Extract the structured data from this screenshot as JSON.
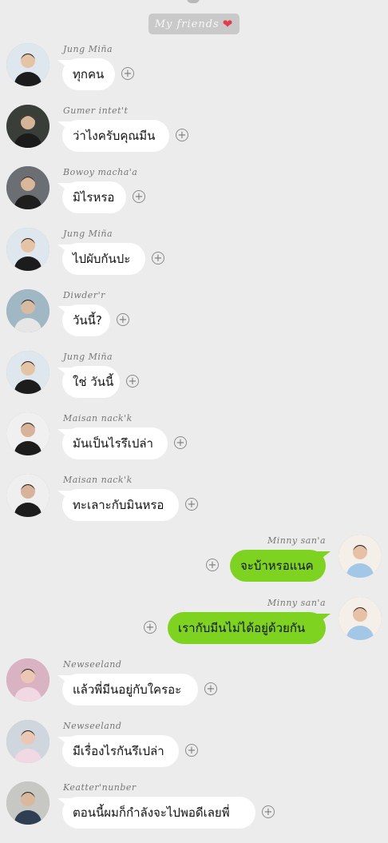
{
  "chat": {
    "title": "My friends",
    "title_icon": "heart-emoji",
    "messages": [
      {
        "side": "left",
        "sender": "Jung Miña",
        "text": "ทุกคน"
      },
      {
        "side": "left",
        "sender": "Gumer intet't",
        "text": "ว่าไงครับคุณมีน"
      },
      {
        "side": "left",
        "sender": "Bowoy macha'a",
        "text": "มิไรหรอ"
      },
      {
        "side": "left",
        "sender": "Jung Miña",
        "text": "ไปผับกันปะ"
      },
      {
        "side": "left",
        "sender": "Diwder'r",
        "text": "วันนี้?"
      },
      {
        "side": "left",
        "sender": "Jung Miña",
        "text": "ใช่ วันนี้"
      },
      {
        "side": "left",
        "sender": "Maisan nack'k",
        "text": "มันเป็นไรรึเปล่า"
      },
      {
        "side": "left",
        "sender": "Maisan nack'k",
        "text": "ทะเลาะกับมินหรอ"
      },
      {
        "side": "right",
        "sender": "Minny san'a",
        "text": "จะบ้าหรอแนค"
      },
      {
        "side": "right",
        "sender": "Minny san'a",
        "text": "เรากับมีนไม่ได้อยู่ด้วยกัน"
      },
      {
        "side": "left",
        "sender": "Newseeland",
        "text": "แล้วพี่มีนอยู่กับใครอะ"
      },
      {
        "side": "left",
        "sender": "Newseeland",
        "text": "มีเรื่องไรกันรึเปล่า"
      },
      {
        "side": "left",
        "sender": "Keatter'nunber",
        "text": "ตอนนี้ผมก็กำลังจะไปพอดีเลยพี่"
      }
    ]
  }
}
